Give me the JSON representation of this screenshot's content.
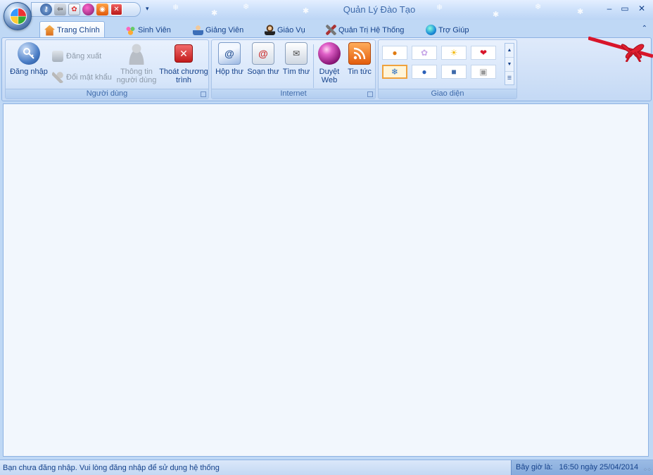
{
  "window": {
    "title": "Quản Lý Đào Tạo",
    "controls": [
      "minimize-icon",
      "maximize-icon",
      "close-icon"
    ]
  },
  "quick_access": {
    "icons": [
      "login-icon",
      "logout-icon",
      "picture-icon",
      "web-browser-icon",
      "rss-icon",
      "exit-icon"
    ],
    "more": "▾"
  },
  "tabs": [
    {
      "label": "Trang Chính",
      "icon": "home-icon",
      "active": true
    },
    {
      "label": "Sinh Viên",
      "icon": "students-icon",
      "active": false
    },
    {
      "label": "Giảng Viên",
      "icon": "teacher-icon",
      "active": false
    },
    {
      "label": "Giáo Vụ",
      "icon": "staff-icon",
      "active": false
    },
    {
      "label": "Quản Trị Hệ Thống",
      "icon": "tools-icon",
      "active": false
    },
    {
      "label": "Trợ Giúp",
      "icon": "help-icon",
      "active": false
    }
  ],
  "groups": {
    "user": {
      "label": "Người dùng",
      "login": "Đăng nhập",
      "logout": "Đăng xuất",
      "change_password": "Đổi mật khẩu",
      "user_info_line1": "Thông tin",
      "user_info_line2": "người dùng",
      "exit_line1": "Thoát chương",
      "exit_line2": "trình"
    },
    "internet": {
      "label": "Internet",
      "inbox": "Hộp thư",
      "compose": "Soạn thư",
      "search_mail": "Tìm thư",
      "browse_line1": "Duyệt",
      "browse_line2": "Web",
      "news": "Tin tức"
    },
    "theme": {
      "label": "Giao diện",
      "swatches": [
        "pumpkin-icon",
        "flower-icon",
        "sun-icon",
        "heart-icon",
        "snowflake-icon",
        "apple-icon",
        "blue-square-icon",
        "gray-square-icon"
      ],
      "selected_index": 4
    }
  },
  "status": {
    "message": "Bạn chưa đăng nhập.  Vui lòng đăng nhập để sử dụng hệ thống",
    "time_label": "Bây giờ là:",
    "time_value": "16:50 ngày 25/04/2014"
  },
  "colors": {
    "accent": "#15428b",
    "ribbon": "#d7e6fa",
    "workspace": "#f2f7fd",
    "bow": "#d8152a"
  }
}
